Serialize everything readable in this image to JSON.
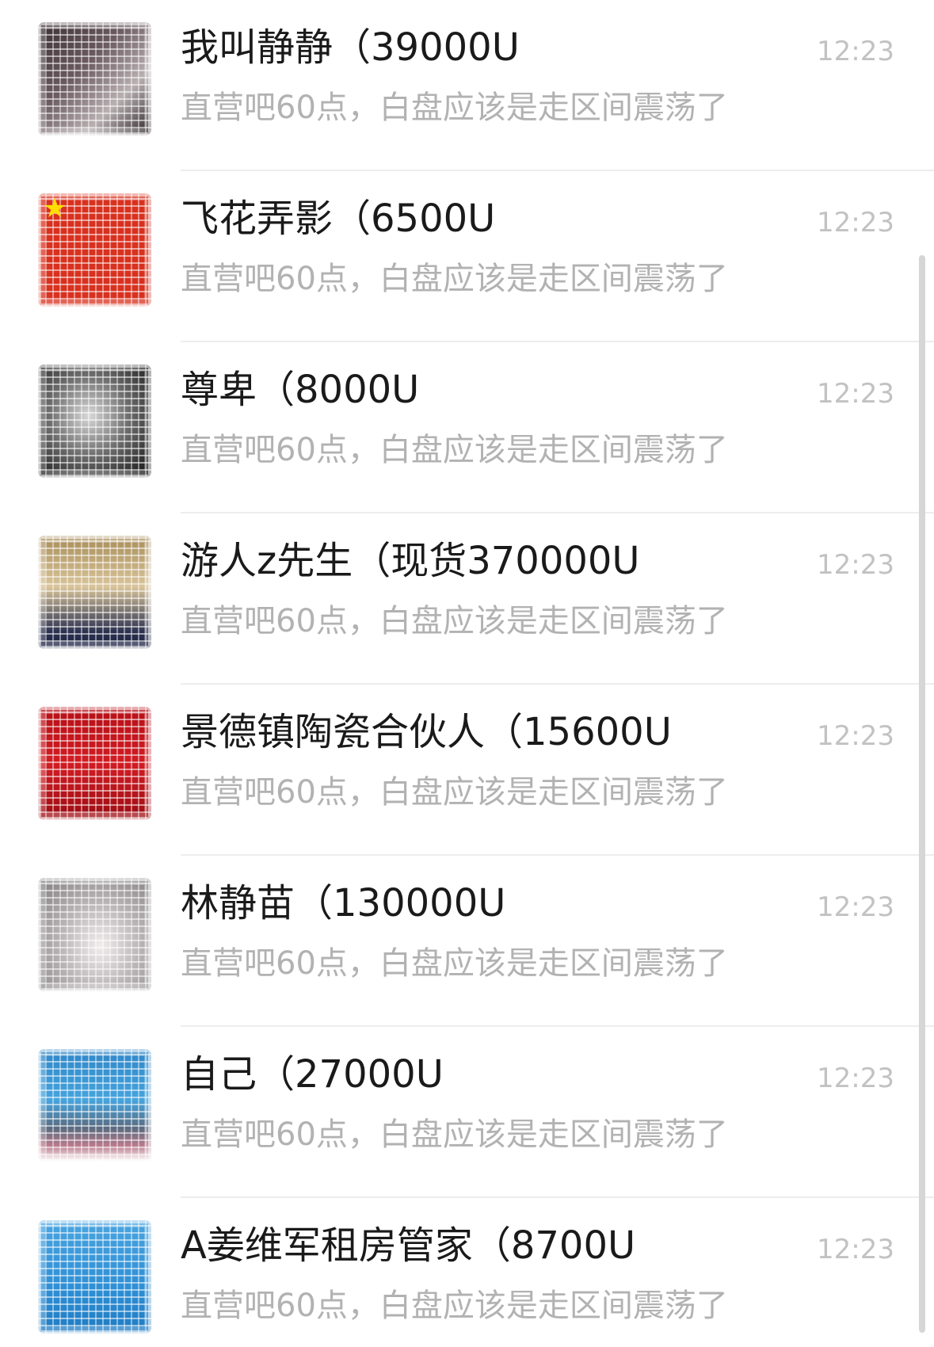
{
  "chat_list": {
    "items": [
      {
        "name": "我叫静静（39000U",
        "preview": "直营吧60点，白盘应该是走区间震荡了",
        "time": "12:23",
        "avatar_icon": "user-avatar-photo"
      },
      {
        "name": "飞花弄影（6500U",
        "preview": "直营吧60点，白盘应该是走区间震荡了",
        "time": "12:23",
        "avatar_icon": "china-flag-avatar"
      },
      {
        "name": "尊卑（8000U",
        "preview": "直营吧60点，白盘应该是走区间震荡了",
        "time": "12:23",
        "avatar_icon": "user-avatar-photo"
      },
      {
        "name": "游人z先生（现货370000U",
        "preview": "直营吧60点，白盘应该是走区间震荡了",
        "time": "12:23",
        "avatar_icon": "user-avatar-photo"
      },
      {
        "name": "景德镇陶瓷合伙人（15600U",
        "preview": "直营吧60点，白盘应该是走区间震荡了",
        "time": "12:23",
        "avatar_icon": "user-avatar-photo"
      },
      {
        "name": "林静苗（130000U",
        "preview": "直营吧60点，白盘应该是走区间震荡了",
        "time": "12:23",
        "avatar_icon": "user-avatar-photo"
      },
      {
        "name": "自己（27000U",
        "preview": "直营吧60点，白盘应该是走区间震荡了",
        "time": "12:23",
        "avatar_icon": "user-avatar-photo"
      },
      {
        "name": "A姜维军租房管家（8700U",
        "preview": "直营吧60点，白盘应该是走区间震荡了",
        "time": "12:23",
        "avatar_icon": "user-avatar-photo"
      }
    ]
  },
  "colors": {
    "name_text": "#1a1a1a",
    "preview_text": "#b2b2b2",
    "time_text": "#c2c2c2",
    "divider": "#ededed",
    "flag_red": "#d8311f",
    "flag_star": "#ffde00"
  }
}
